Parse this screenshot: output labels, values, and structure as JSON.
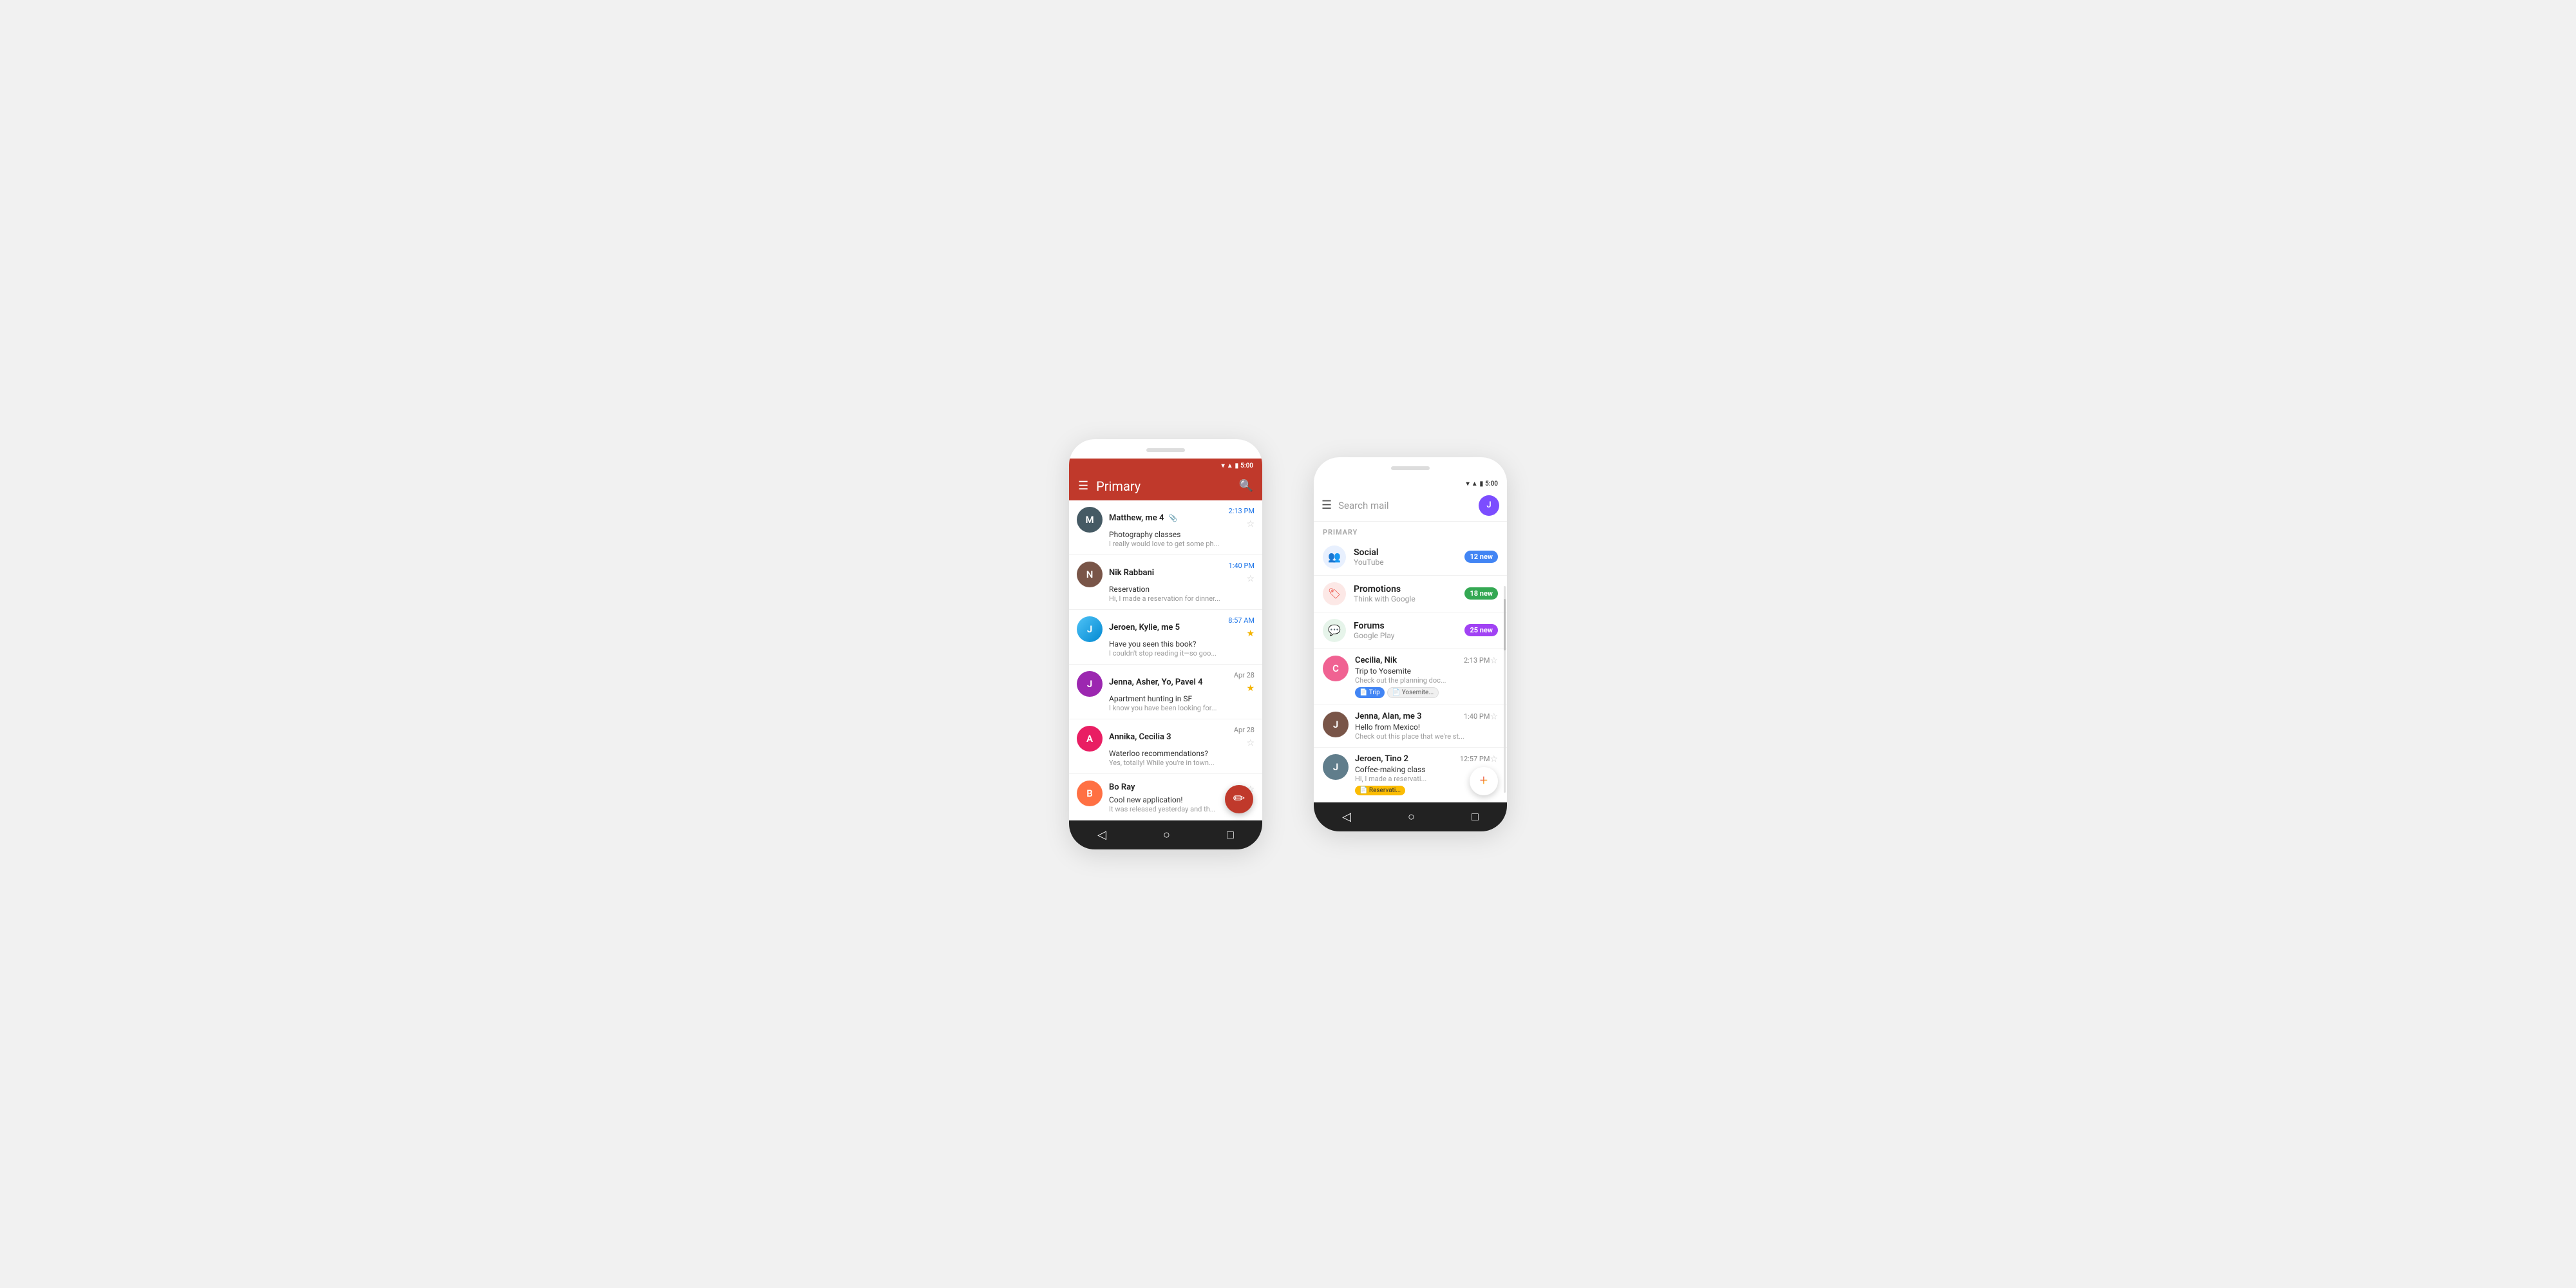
{
  "phone1": {
    "status": {
      "time": "5:00"
    },
    "header": {
      "title": "Primary",
      "menu_label": "≡",
      "search_label": "🔍"
    },
    "emails": [
      {
        "sender": "Matthew, me 4",
        "subject": "Photography classes",
        "preview": "I really would love to get some ph...",
        "time": "2:13 PM",
        "time_blue": true,
        "star": false,
        "has_attach": true,
        "avatar_initials": "M",
        "avatar_class": "av-matthew"
      },
      {
        "sender": "Nik Rabbani",
        "subject": "Reservation",
        "preview": "Hi, I made a reservation for dinner...",
        "time": "1:40 PM",
        "time_blue": true,
        "star": false,
        "has_attach": false,
        "avatar_initials": "N",
        "avatar_class": "av-nik"
      },
      {
        "sender": "Jeroen, Kylie, me 5",
        "subject": "Have you seen this book?",
        "preview": "I couldn't stop reading it—so goo...",
        "time": "8:57 AM",
        "time_blue": true,
        "star": true,
        "has_attach": false,
        "avatar_initials": "J",
        "avatar_class": "av-jeroen"
      },
      {
        "sender": "Jenna, Asher, Yo, Pavel 4",
        "subject": "Apartment hunting in SF",
        "preview": "I know you have been looking for...",
        "time": "Apr 28",
        "time_blue": false,
        "star": true,
        "has_attach": false,
        "avatar_initials": "J",
        "avatar_class": "av-jenna"
      },
      {
        "sender": "Annika, Cecilia 3",
        "subject": "Waterloo recommendations?",
        "preview": "Yes, totally! While you're in town...",
        "time": "Apr 28",
        "time_blue": false,
        "star": false,
        "has_attach": false,
        "avatar_initials": "A",
        "avatar_class": "av-annika"
      },
      {
        "sender": "Bo Ray",
        "subject": "Cool new application!",
        "preview": "It was released yesterday and th...",
        "time": "",
        "time_blue": false,
        "star": false,
        "has_attach": false,
        "avatar_initials": "B",
        "avatar_class": "av-bo"
      }
    ],
    "fab_label": "✏"
  },
  "phone2": {
    "status": {
      "time": "5:00"
    },
    "search_placeholder": "Search mail",
    "section_label": "PRIMARY",
    "categories": [
      {
        "name": "Social",
        "sub": "YouTube",
        "badge": "12 new",
        "badge_class": "blue",
        "icon": "👥",
        "icon_class": "social"
      },
      {
        "name": "Promotions",
        "sub": "Think with Google",
        "badge": "18 new",
        "badge_class": "green",
        "icon": "🏷",
        "icon_class": "promo"
      },
      {
        "name": "Forums",
        "sub": "Google Play",
        "badge": "25 new",
        "badge_class": "purple",
        "icon": "💬",
        "icon_class": "forum"
      }
    ],
    "emails": [
      {
        "sender": "Cecilia, Nik",
        "subject": "Trip to Yosemite",
        "preview": "Check out the planning doc...",
        "time": "2:13 PM",
        "star": false,
        "chips": [
          "Trip",
          "Yosemite..."
        ],
        "avatar_initials": "C",
        "avatar_class": "av-cecilia"
      },
      {
        "sender": "Jenna, Alan, me 3",
        "subject": "Hello from Mexico!",
        "preview": "Check out this place that we're st...",
        "time": "1:40 PM",
        "star": false,
        "chips": [],
        "avatar_initials": "J",
        "avatar_class": "av-jenna2"
      },
      {
        "sender": "Jeroen, Tino 2",
        "subject": "Coffee-making class",
        "preview": "Hi, I made a reservati...",
        "time": "12:57 PM",
        "star": false,
        "chips": [
          "Reservati..."
        ],
        "avatar_initials": "J",
        "avatar_class": "av-jeroen2"
      }
    ]
  }
}
